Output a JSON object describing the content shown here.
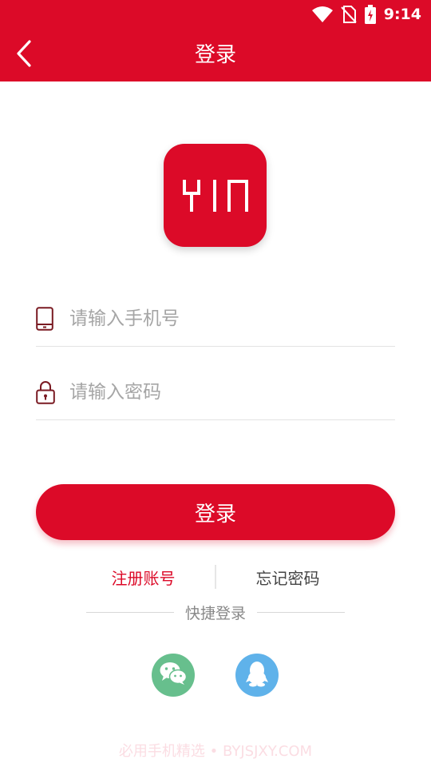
{
  "status_bar": {
    "time": "9:14"
  },
  "header": {
    "title": "登录"
  },
  "logo": {
    "text": "YIN"
  },
  "form": {
    "phone_placeholder": "请输入手机号",
    "phone_value": "",
    "password_placeholder": "请输入密码",
    "password_value": ""
  },
  "actions": {
    "login_label": "登录",
    "register_label": "注册账号",
    "forgot_label": "忘记密码"
  },
  "quick_login": {
    "label": "快捷登录"
  },
  "watermark": "必用手机精选 • BYJSJXY.COM",
  "colors": {
    "brand_red": "#dc0a28",
    "wechat_green": "#67bf8d",
    "qq_blue": "#5fb2ea"
  },
  "icons": {
    "back": "chevron-left-icon",
    "phone": "phone-icon",
    "lock": "lock-icon",
    "wechat": "wechat-icon",
    "qq": "qq-icon"
  }
}
